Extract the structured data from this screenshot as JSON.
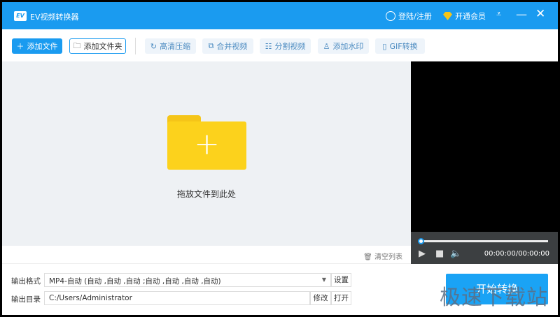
{
  "title_bar": {
    "logo": "EV",
    "app_title": "EV视频转换器",
    "login_label": "登陆/注册",
    "vip_label": "开通会员"
  },
  "toolbar": {
    "add_file": "添加文件",
    "add_folder": "添加文件夹",
    "tools": [
      "高清压缩",
      "合并视频",
      "分割视频",
      "添加水印",
      "GIF转换"
    ]
  },
  "drop_area": {
    "hint": "拖放文件到此处"
  },
  "list": {
    "clear_label": "清空列表"
  },
  "player": {
    "time": "00:00:00/00:00:00",
    "progress": 0
  },
  "output": {
    "format_label": "输出格式",
    "format_value": "MP4-自动 (自动 ,自动 ,自动 ;自动 ,自动 ,自动 ,自动)",
    "settings_label": "设置",
    "dir_label": "输出目录",
    "dir_value": "C:/Users/Administrator",
    "modify_label": "修改",
    "open_label": "打开"
  },
  "start_label": "开始转换",
  "watermark": "极速下载站",
  "colors": {
    "accent": "#1a9bf0",
    "folder": "#fcd21c"
  }
}
